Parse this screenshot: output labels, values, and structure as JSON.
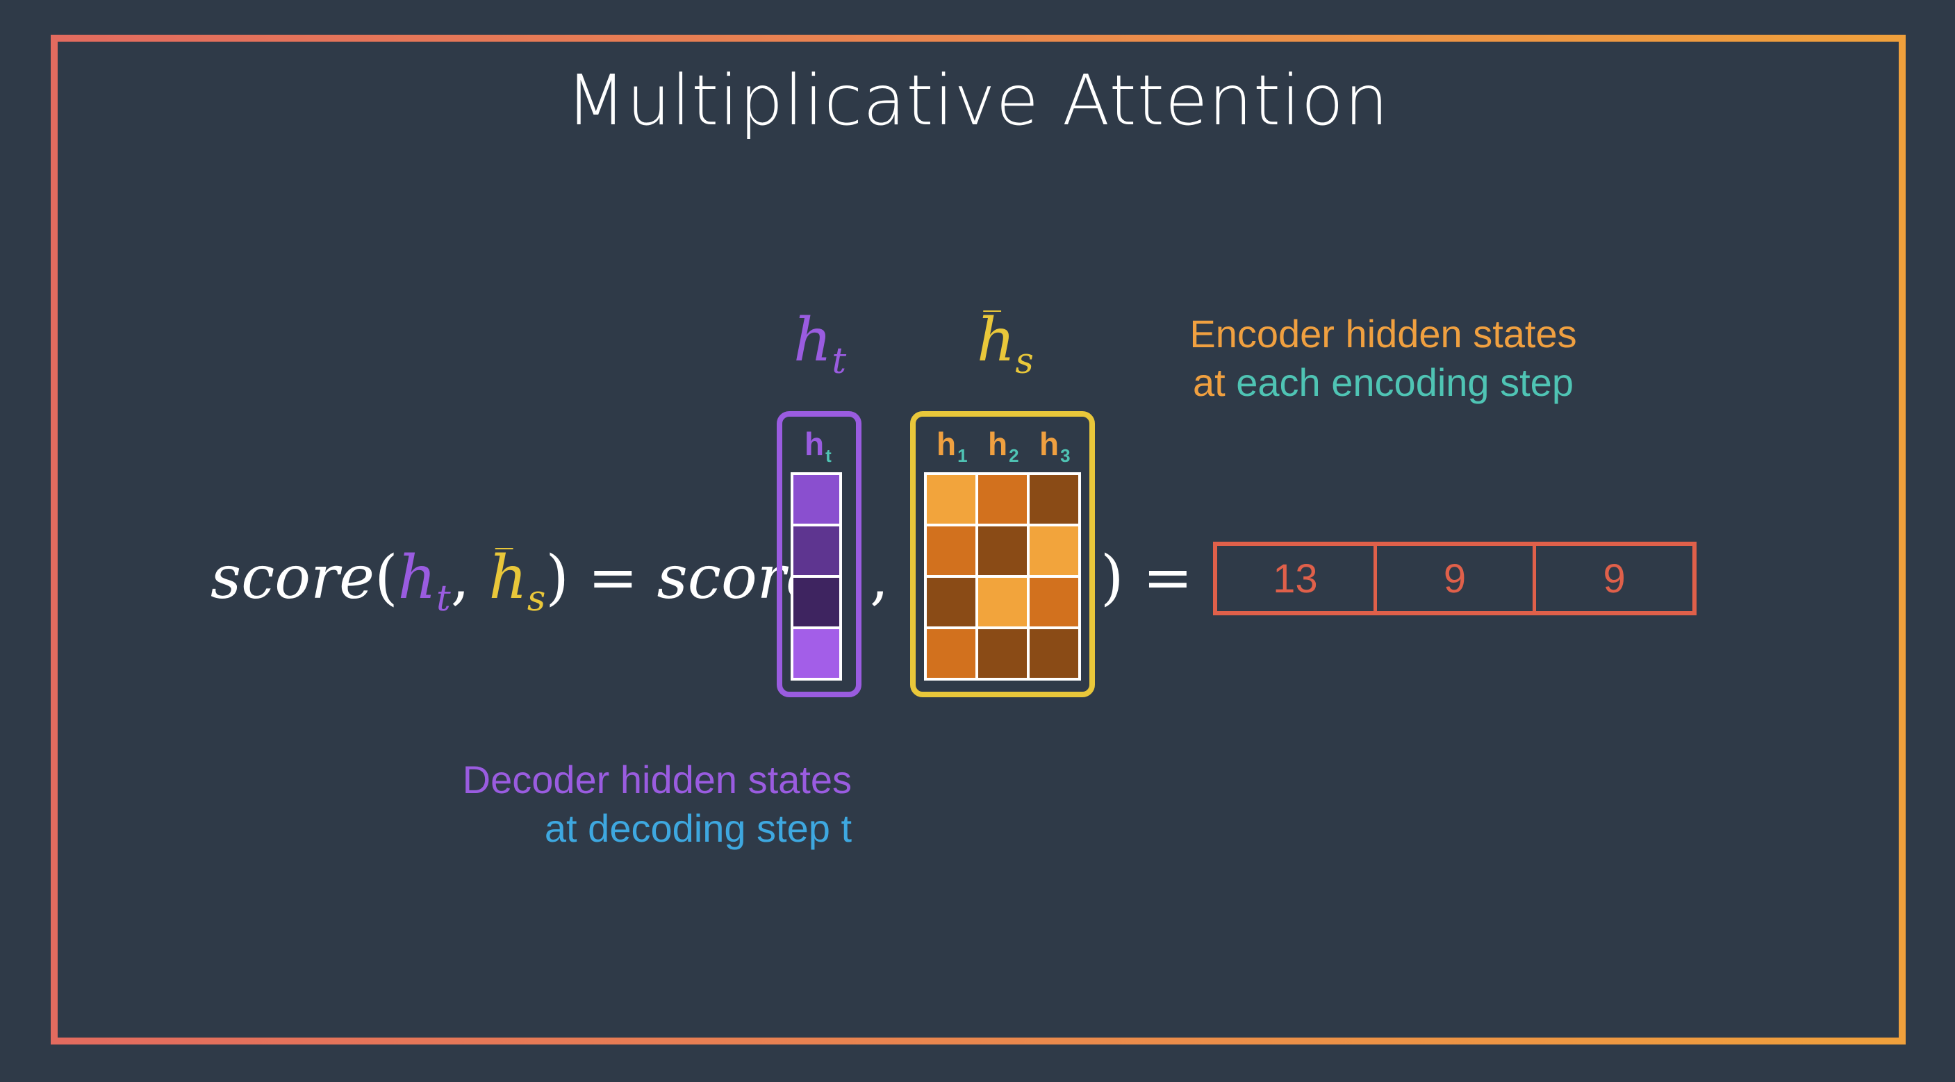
{
  "title": "Multiplicative Attention",
  "equation": {
    "lhs_score": "score",
    "lhs_h": "h",
    "lhs_h_sub": "t",
    "lhs_hs": "h",
    "lhs_hs_sub": "s",
    "equals": "=",
    "rhs_score": "score",
    "bar": "‾"
  },
  "labels": {
    "ht_symbol": "h",
    "ht_symbol_sub": "t",
    "hs_symbol": "h",
    "hs_symbol_sub": "s"
  },
  "decoder_vector": {
    "label": "h",
    "label_sub": "t",
    "cell_colors": [
      "#8a4fcf",
      "#5e3590",
      "#3e2460",
      "#a35ee8"
    ]
  },
  "encoder_matrix": {
    "columns": [
      {
        "label": "h",
        "sub": "1"
      },
      {
        "label": "h",
        "sub": "2"
      },
      {
        "label": "h",
        "sub": "3"
      }
    ],
    "cell_colors": [
      [
        "#f2a43c",
        "#d2711e",
        "#8a4b16"
      ],
      [
        "#d2711e",
        "#8a4b16",
        "#f2a43c"
      ],
      [
        "#8a4b16",
        "#f2a43c",
        "#d2711e"
      ],
      [
        "#d2711e",
        "#8a4b16",
        "#8a4b16"
      ]
    ]
  },
  "encoder_caption": {
    "line1": "Encoder hidden states",
    "line2_prefix": "at",
    "line2_rest": "each encoding step"
  },
  "decoder_caption": {
    "line1": "Decoder hidden states",
    "line2": "at decoding step t"
  },
  "result": [
    "13",
    "9",
    "9"
  ],
  "colors": {
    "background": "#2f3a48",
    "decoder": "#9a5ce0",
    "encoder": "#e9c73a",
    "encoder_caption": "#f0a040",
    "teal": "#4fc4b4",
    "blue": "#3ea8e0",
    "result": "#e0604a"
  }
}
